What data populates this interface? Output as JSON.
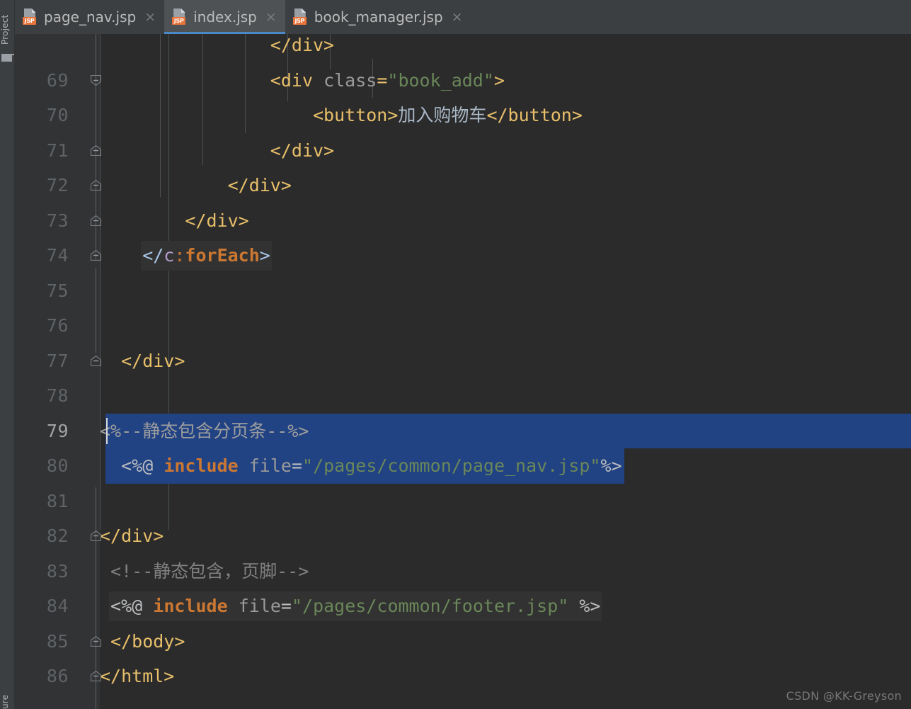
{
  "window": {
    "app": "IntelliJ IDEA Editor",
    "theme": "Darcula"
  },
  "tool_rail": {
    "top_label": "Project",
    "bottom_label": "ure",
    "folder_icon": "folder-icon"
  },
  "tab_bar": {
    "tabs": [
      {
        "label": "page_nav.jsp",
        "icon": "jsp-file-icon",
        "badge": "JSP",
        "close": "×",
        "active": false
      },
      {
        "label": "index.jsp",
        "icon": "jsp-file-icon",
        "badge": "JSP",
        "close": "×",
        "active": true
      },
      {
        "label": "book_manager.jsp",
        "icon": "jsp-file-icon",
        "badge": "JSP",
        "close": "×",
        "active": false
      }
    ]
  },
  "editor": {
    "active_line": 79,
    "selection": {
      "from_line": 79,
      "to_line": 80
    },
    "colors": {
      "background": "#2b2b2b",
      "gutter": "#313335",
      "selection": "#214283",
      "tab_active": "#4e5254",
      "tab_underline": "#4a88c7",
      "tag": "#e8bf6a",
      "attribute": "#9a9a9a",
      "value": "#6a8759",
      "comment": "#808080",
      "keyword": "#cc7832",
      "text": "#a9b7c6",
      "namespace": "#b09bc9",
      "bracket": "#a9c7e8",
      "badge_orange": "#e8743b"
    },
    "lines": [
      {
        "num": "",
        "partial": true,
        "tokens": [
          {
            "t": "</div>",
            "c": "t-tag"
          }
        ]
      },
      {
        "num": "69",
        "fold": "end",
        "tokens": [
          {
            "t": "<div ",
            "c": "t-tag"
          },
          {
            "t": "class",
            "c": "t-attr"
          },
          {
            "t": "=",
            "c": "t-tag"
          },
          {
            "t": "\"book_add\"",
            "c": "t-val"
          },
          {
            "t": ">",
            "c": "t-tag"
          }
        ]
      },
      {
        "num": "70",
        "tokens": [
          {
            "t": "<button>",
            "c": "t-tag"
          },
          {
            "t": "加入购物车",
            "c": "t-text"
          },
          {
            "t": "</button>",
            "c": "t-tag"
          }
        ]
      },
      {
        "num": "71",
        "fold": "close",
        "tokens": [
          {
            "t": "</div>",
            "c": "t-tag"
          }
        ]
      },
      {
        "num": "72",
        "fold": "close",
        "tokens": [
          {
            "t": "</div>",
            "c": "t-tag"
          }
        ]
      },
      {
        "num": "73",
        "fold": "close",
        "tokens": [
          {
            "t": "</div>",
            "c": "t-tag"
          }
        ]
      },
      {
        "num": "74",
        "fold": "close",
        "block": true,
        "tokens": [
          {
            "t": "</",
            "c": "t-brk"
          },
          {
            "t": "c",
            "c": "t-ns"
          },
          {
            "t": ":",
            "c": "t-colon"
          },
          {
            "t": "forEach",
            "c": "t-cname"
          },
          {
            "t": ">",
            "c": "t-brk"
          }
        ]
      },
      {
        "num": "75",
        "tokens": []
      },
      {
        "num": "76",
        "tokens": []
      },
      {
        "num": "77",
        "fold": "close",
        "tokens": [
          {
            "t": "</div>",
            "c": "t-tag"
          }
        ]
      },
      {
        "num": "78",
        "tokens": []
      },
      {
        "num": "79",
        "selected": true,
        "current": true,
        "tokens": [
          {
            "t": "<%--静态包含分页条--%>",
            "c": "t-comment"
          }
        ]
      },
      {
        "num": "80",
        "selected": true,
        "tokens": [
          {
            "t": "<%@ ",
            "c": "t-jsp"
          },
          {
            "t": "include",
            "c": "t-kw"
          },
          {
            "t": " ",
            "c": "t-jsp"
          },
          {
            "t": "file",
            "c": "t-attr"
          },
          {
            "t": "=",
            "c": "t-jsp"
          },
          {
            "t": "\"",
            "c": "t-val"
          },
          {
            "t": "/pages/common/page_nav.jsp",
            "c": "t-val"
          },
          {
            "t": "\"",
            "c": "t-val"
          },
          {
            "t": "%>",
            "c": "t-jsp"
          }
        ]
      },
      {
        "num": "81",
        "tokens": []
      },
      {
        "num": "82",
        "fold": "close",
        "tokens": [
          {
            "t": "</div>",
            "c": "t-tag"
          }
        ]
      },
      {
        "num": "83",
        "tokens": [
          {
            "t": "<!--静态包含，页脚-->",
            "c": "t-comment"
          }
        ]
      },
      {
        "num": "84",
        "block": true,
        "tokens": [
          {
            "t": "<%@ ",
            "c": "t-jsp"
          },
          {
            "t": "include",
            "c": "t-kw"
          },
          {
            "t": " ",
            "c": "t-jsp"
          },
          {
            "t": "file",
            "c": "t-attr"
          },
          {
            "t": "=",
            "c": "t-jsp"
          },
          {
            "t": "\"",
            "c": "t-val"
          },
          {
            "t": "/pages/common/footer.jsp",
            "c": "t-val"
          },
          {
            "t": "\"",
            "c": "t-val"
          },
          {
            "t": " %>",
            "c": "t-jsp"
          }
        ]
      },
      {
        "num": "85",
        "fold": "close",
        "tokens": [
          {
            "t": "</body>",
            "c": "t-tag"
          }
        ]
      },
      {
        "num": "86",
        "fold": "close",
        "tokens": [
          {
            "t": "</html>",
            "c": "t-tag"
          }
        ]
      }
    ]
  },
  "watermark": {
    "text": "CSDN @KK-Greyson"
  }
}
